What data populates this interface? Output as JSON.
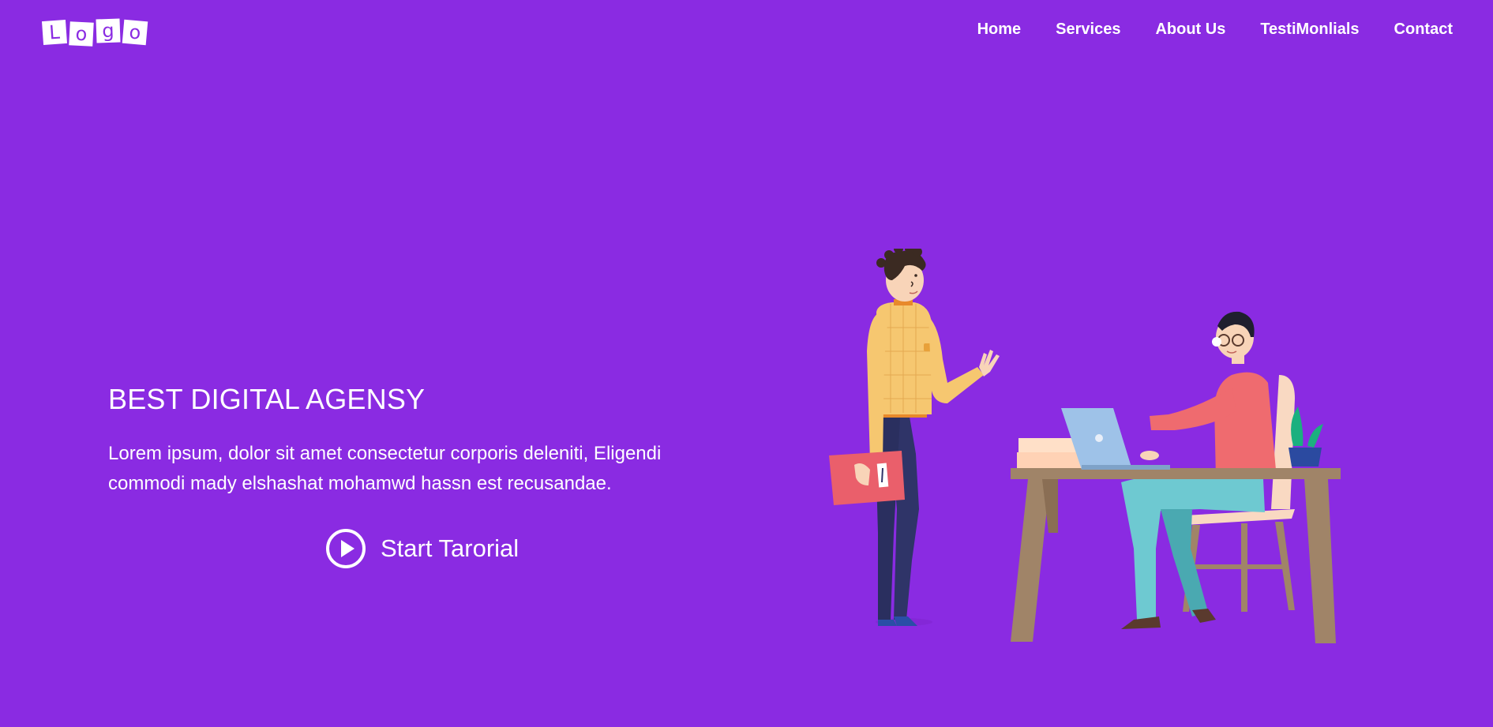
{
  "logo": {
    "letters": [
      "L",
      "o",
      "g",
      "o"
    ]
  },
  "nav": {
    "items": [
      {
        "label": "Home"
      },
      {
        "label": "Services"
      },
      {
        "label": "About Us"
      },
      {
        "label": "TestiMonlials"
      },
      {
        "label": "Contact"
      }
    ]
  },
  "hero": {
    "title": "BEST DIGITAL AGENSY",
    "text": "Lorem ipsum, dolor sit amet consectetur corporis deleniti, Eligendi commodi mady elshashat mohamwd hassn est recusandae.",
    "cta_label": "Start Tarorial",
    "cta_icon": "play-circle-icon",
    "illustration": "office-illustration"
  },
  "colors": {
    "background": "#8a2be2",
    "text": "#ffffff"
  }
}
